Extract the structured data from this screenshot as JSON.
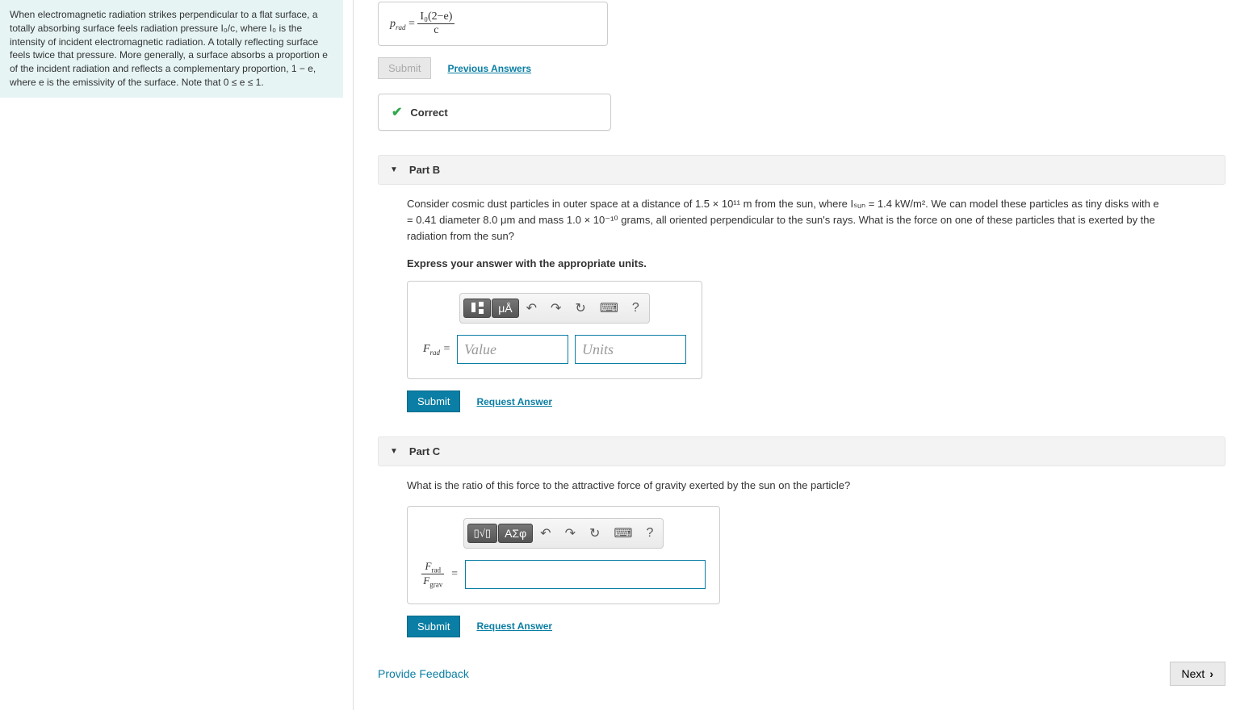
{
  "intro": "When electromagnetic radiation strikes perpendicular to a flat surface, a totally absorbing surface feels radiation pressure I₀/c, where I₀ is the intensity of incident electromagnetic radiation. A totally reflecting surface feels twice that pressure. More generally, a surface absorbs a proportion e of the incident radiation and reflects a complementary proportion, 1 − e, where e is the emissivity of the surface. Note that 0 ≤ e ≤ 1.",
  "partA": {
    "result_prefix": "p",
    "result_sub": "rad",
    "result_eq": "=",
    "frac_num": "I₀(2−e)",
    "frac_den": "c",
    "submit": "Submit",
    "prev": "Previous Answers",
    "correct": "Correct"
  },
  "partB": {
    "header": "Part B",
    "question": "Consider cosmic dust particles in outer space at a distance of 1.5 × 10¹¹ m from the sun, where Iₛᵤₙ = 1.4 kW/m². We can model these particles as tiny disks with e = 0.41 diameter 8.0 μm and mass 1.0 × 10⁻¹⁰ grams, all oriented perpendicular to the sun's rays. What is the force on one of these particles that is exerted by the radiation from the sun?",
    "express": "Express your answer with the appropriate units.",
    "toolbar": {
      "tmpl": "▯",
      "units": "μÅ",
      "undo": "↶",
      "redo": "↷",
      "reset": "↻",
      "kbd": "⌨",
      "help": "?"
    },
    "var_label": "F",
    "var_sub": "rad",
    "value_ph": "Value",
    "units_ph": "Units",
    "submit": "Submit",
    "request": "Request Answer"
  },
  "partC": {
    "header": "Part C",
    "question": "What is the ratio of this force to the attractive force of gravity exerted by the sun on the particle?",
    "toolbar": {
      "tmpl": "▯",
      "sym": "ΑΣφ",
      "undo": "↶",
      "redo": "↷",
      "reset": "↻",
      "kbd": "⌨",
      "help": "?"
    },
    "ratio_num": "Frad",
    "ratio_den": "Fgrav",
    "submit": "Submit",
    "request": "Request Answer"
  },
  "footer": {
    "provide": "Provide Feedback",
    "next": "Next"
  }
}
